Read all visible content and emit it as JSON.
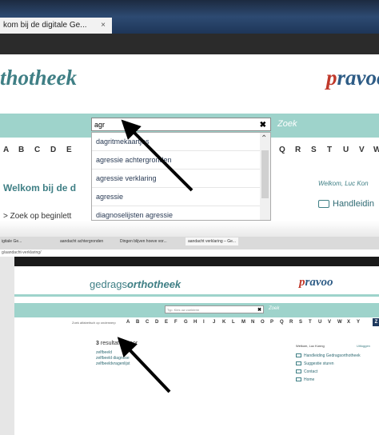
{
  "top_screenshot": {
    "tab_title": "kom bij de digitale Ge...",
    "tab_close": "×",
    "site_title": "thotheek",
    "pravoo_logo": {
      "first": "p",
      "rest": "ravoo"
    },
    "search_value": "agr",
    "search_clear": "✖",
    "search_button": "Zoek",
    "alphabet_left": [
      "A",
      "B",
      "C",
      "D",
      "E"
    ],
    "alphabet_right": [
      "Q",
      "R",
      "S",
      "T",
      "U",
      "V",
      "W"
    ],
    "suggestions": [
      "dagritmekaartjes",
      "agressie achtergronden",
      "agressie verklaring",
      "agressie",
      "diagnoselijsten agressie"
    ],
    "welcome_heading": "Welkom bij de d",
    "zoek_op_text": "> Zoek op beginlett",
    "greeting": "Welkom, Luc Kon",
    "handleiding": "Handleidin",
    "colors": {
      "teal": "#9ed3cb",
      "accent": "#3f7f85",
      "dark_blue": "#2e5c86"
    }
  },
  "bottom_screenshot": {
    "tabs": [
      "igitale Ge...",
      "aandacht achtergronden",
      "Dingen blijven hoeve vor...",
      "aandacht verklaring – Ge..."
    ],
    "url": "g/aandacht-verklaring/",
    "brand": {
      "plain": "gedrags",
      "italic": "orthotheek"
    },
    "pravoo_logo": {
      "first": "p",
      "rest": "ravoo"
    },
    "search_placeholder": "Typ. Kies uw zoekterm",
    "search_clear": "✖",
    "search_button": "Zoek",
    "alpha_hint": "Zoek alfabetisch op onderwerp",
    "alphabet": [
      "A",
      "B",
      "C",
      "D",
      "E",
      "F",
      "G",
      "H",
      "I",
      "J",
      "K",
      "L",
      "M",
      "N",
      "O",
      "P",
      "Q",
      "R",
      "S",
      "T",
      "U",
      "V",
      "W",
      "X",
      "Y"
    ],
    "selected_letter": "Z",
    "results_count": "3",
    "results_label": "resultaten voor",
    "results": [
      "zelfbeeld",
      "zelfbeeld diagnose",
      "zelfbeeldvragenlijst"
    ],
    "greeting": "Welkom, Luc Konng",
    "logout": "Uitloggen",
    "side_links": [
      "Handleiding Gedragsorthotheek",
      "Suggestie sturen",
      "Contact",
      "Home"
    ]
  }
}
